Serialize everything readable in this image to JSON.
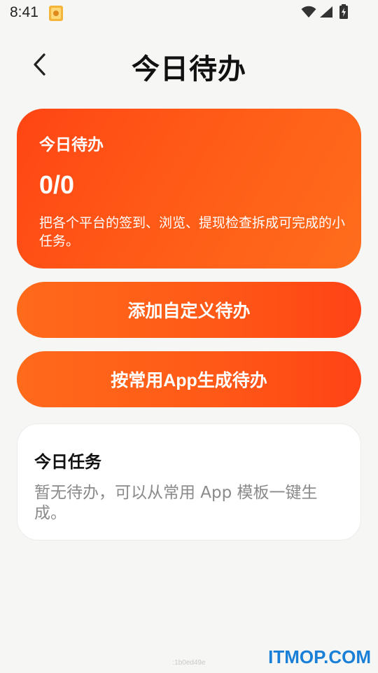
{
  "status_bar": {
    "time": "8:41"
  },
  "header": {
    "title": "今日待办"
  },
  "summary": {
    "title": "今日待办",
    "count": "0/0",
    "description": "把各个平台的签到、浏览、提现检查拆成可完成的小任务。"
  },
  "actions": {
    "add_custom": "添加自定义待办",
    "generate_from_app": "按常用App生成待办"
  },
  "tasks": {
    "title": "今日任务",
    "empty_text": "暂无待办，可以从常用 App 模板一键生成。"
  },
  "footer": {
    "build_tag": ":1b0ed49e",
    "watermark": "ITMOP.COM"
  },
  "colors": {
    "accent": "#ff5a17",
    "background": "#f6f6f4",
    "watermark": "#1a7fd6"
  }
}
